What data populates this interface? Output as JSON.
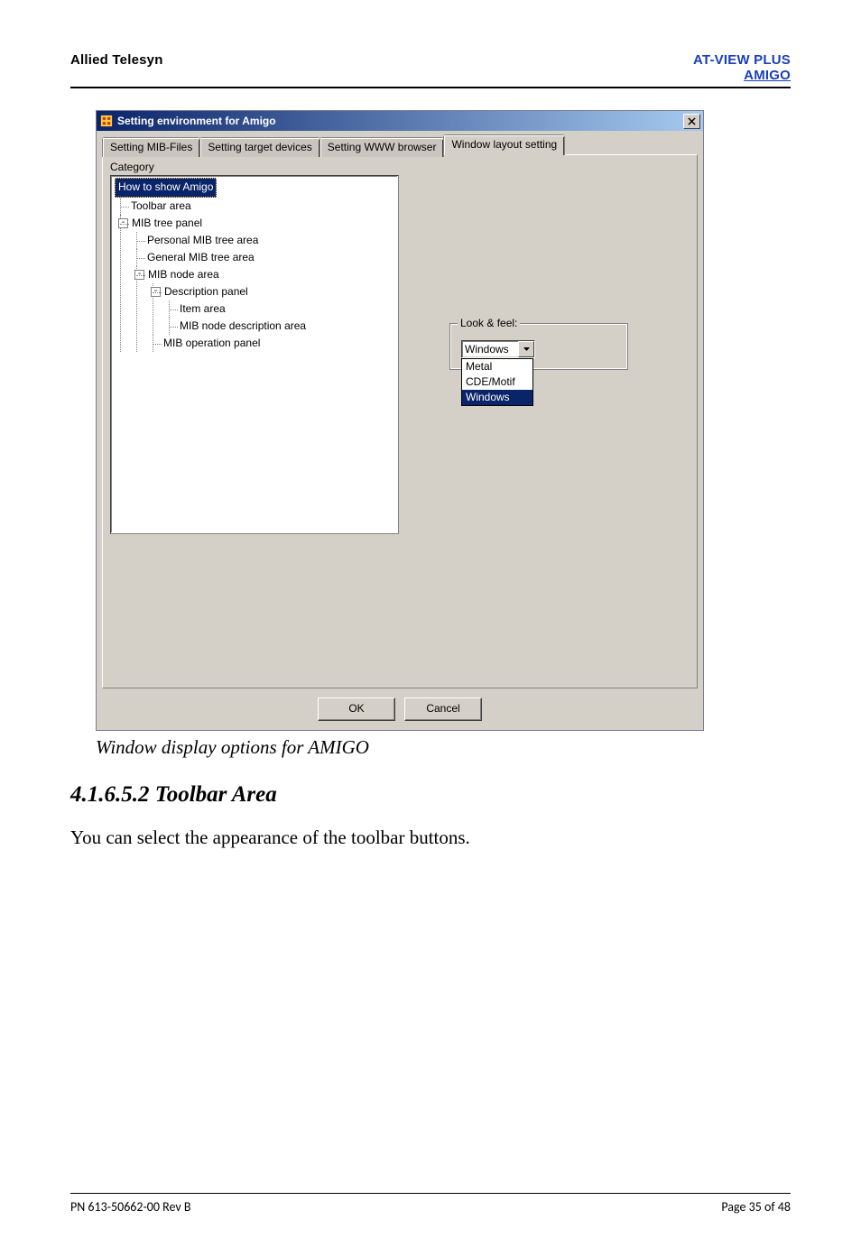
{
  "header": {
    "left": "Allied Telesyn",
    "right_line1": "AT-VIEW PLUS",
    "right_line2": "AMIGO"
  },
  "dialog": {
    "title": "Setting environment for Amigo",
    "tabs": {
      "t1": "Setting MIB-Files",
      "t2": "Setting target devices",
      "t3": "Setting WWW browser",
      "t4": "Window layout setting"
    },
    "category_label": "Category",
    "tree": {
      "root": "How to show Amigo",
      "n1": "Toolbar area",
      "n2": "MIB tree panel",
      "n2a": "Personal MIB tree area",
      "n2b": "General MIB tree area",
      "n2c": "MIB node area",
      "n2c1": "Description panel",
      "n2c1a": "Item area",
      "n2c1b": "MIB node description area",
      "n2c2": "MIB operation panel"
    },
    "look_feel": {
      "legend": "Look & feel:",
      "selected": "Windows",
      "options": {
        "o1": "Metal",
        "o2": "CDE/Motif",
        "o3": "Windows"
      }
    },
    "buttons": {
      "ok": "OK",
      "cancel": "Cancel"
    }
  },
  "caption": "Window display options for AMIGO",
  "section_heading": "4.1.6.5.2 Toolbar Area",
  "body": "You can select the appearance of the toolbar buttons.",
  "footer": {
    "left": "PN 613-50662-00 Rev B",
    "right": "Page 35 of 48"
  }
}
